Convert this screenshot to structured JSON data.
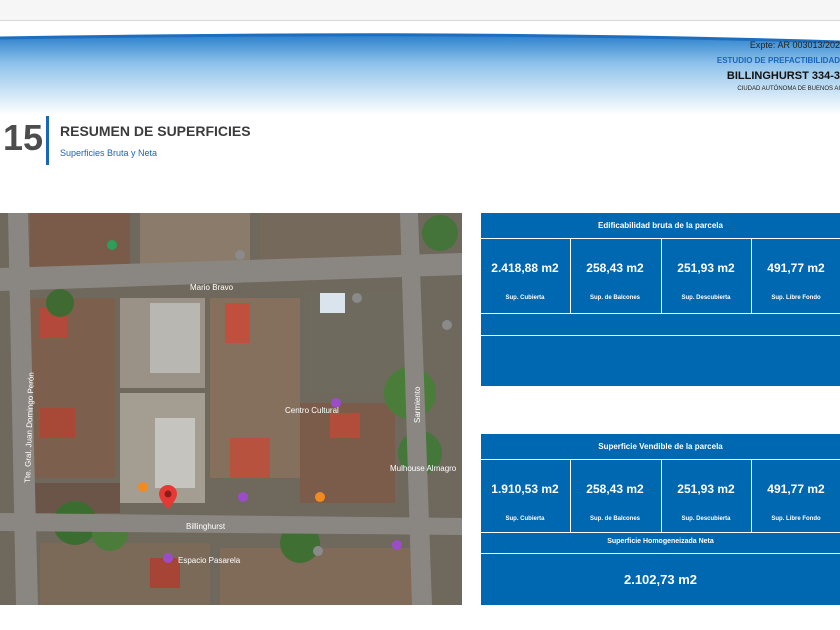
{
  "header": {
    "expte": "Expte: AR 003013/202",
    "estudio": "ESTUDIO DE PREFACTIBILIDAD",
    "address": "BILLINGHURST 334-3",
    "city": "CIUDAD AUTÓNOMA DE BUENOS AI"
  },
  "section": {
    "number": "15",
    "title": "RESUMEN DE SUPERFICIES",
    "subtitle": "Superficies Bruta y Neta"
  },
  "map": {
    "labels": [
      "Mario Bravo",
      "Billinghurst",
      "Sarmiento",
      "Tte. Gral. Juan Domingo Perón",
      "Centro Cultural",
      "Mulhouse Almagro",
      "Espacio Pasarela"
    ]
  },
  "bruta": {
    "title": "Edificabilidad bruta de la parcela",
    "cells": [
      {
        "value": "2.418,88 m2",
        "label": "Sup. Cubierta"
      },
      {
        "value": "258,43 m2",
        "label": "Sup. de Balcones"
      },
      {
        "value": "251,93 m2",
        "label": "Sup. Descubierta"
      },
      {
        "value": "491,77 m2",
        "label": "Sup. Libre Fondo"
      }
    ]
  },
  "vendible": {
    "title": "Superficie Vendible de la parcela",
    "cells": [
      {
        "value": "1.910,53 m2",
        "label": "Sup. Cubierta"
      },
      {
        "value": "258,43 m2",
        "label": "Sup. de Balcones"
      },
      {
        "value": "251,93 m2",
        "label": "Sup. Descubierta"
      },
      {
        "value": "491,77 m2",
        "label": "Sup. Libre Fondo"
      }
    ],
    "neto_title": "Superficie Homogeneizada Neta",
    "neto_value": "2.102,73 m2"
  },
  "colors": {
    "panel_blue": "#0067b1",
    "accent_blue": "#1a66b8",
    "pin_red": "#e53935"
  }
}
